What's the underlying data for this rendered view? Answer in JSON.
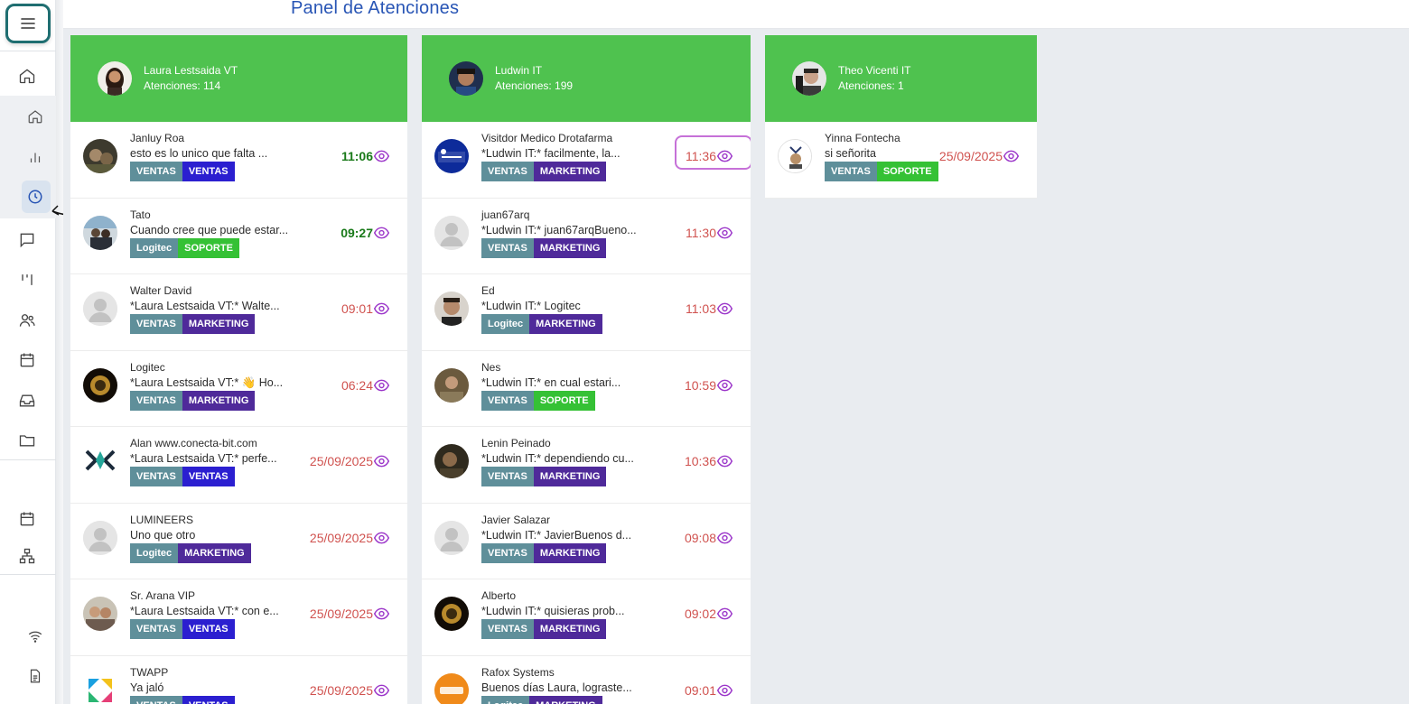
{
  "header": {
    "title": "Panel de Atenciones"
  },
  "colors": {
    "header_green": "#4fc24f",
    "title_blue": "#2855b5",
    "tag_gray": "#5f8f9a",
    "tag_blue": "#2b1fd0",
    "tag_purple": "#4f2a9a",
    "tag_green": "#35c135",
    "time_red": "#d0524f",
    "time_green": "#1a7a1a",
    "eye_purple": "#9b35c9"
  },
  "sidebar": {
    "items": [
      {
        "icon": "menu-icon"
      },
      {
        "icon": "home-icon"
      },
      {
        "icon": "home-sub-icon"
      },
      {
        "icon": "bar-chart-icon"
      },
      {
        "icon": "clock-icon"
      },
      {
        "icon": "chat-icon"
      },
      {
        "icon": "kanban-icon"
      },
      {
        "icon": "users-icon"
      },
      {
        "icon": "calendar-icon"
      },
      {
        "icon": "inbox-icon"
      },
      {
        "icon": "folder-icon"
      },
      {
        "icon": "calendar-alt-icon"
      },
      {
        "icon": "sitemap-icon"
      },
      {
        "icon": "wifi-icon"
      },
      {
        "icon": "document-icon"
      }
    ]
  },
  "columns": [
    {
      "agent": "Laura Lestsaida VT",
      "count": "Atenciones: 114",
      "tickets": [
        {
          "name": "Janluy Roa",
          "msg": "esto es lo unico que falta ...",
          "tags": [
            "VENTAS",
            "VENTAS"
          ],
          "time": "11:06"
        },
        {
          "name": "Tato",
          "msg": "Cuando cree que puede estar...",
          "tags": [
            "Logitec",
            "SOPORTE"
          ],
          "time": "09:27"
        },
        {
          "name": "Walter David",
          "msg": "*Laura Lestsaida VT:* Walte...",
          "tags": [
            "VENTAS",
            "MARKETING"
          ],
          "time": "09:01"
        },
        {
          "name": "Logitec",
          "msg": "*Laura Lestsaida VT:* 👋 Ho...",
          "tags": [
            "VENTAS",
            "MARKETING"
          ],
          "time": "06:24"
        },
        {
          "name": "Alan www.conecta-bit.com",
          "msg": "*Laura Lestsaida VT:* perfe...",
          "tags": [
            "VENTAS",
            "VENTAS"
          ],
          "time": "25/09/2025"
        },
        {
          "name": "LUMINEERS",
          "msg": "Uno que otro",
          "tags": [
            "Logitec",
            "MARKETING"
          ],
          "time": "25/09/2025"
        },
        {
          "name": "Sr. Arana VIP",
          "msg": "*Laura Lestsaida VT:* con e...",
          "tags": [
            "VENTAS",
            "VENTAS"
          ],
          "time": "25/09/2025"
        },
        {
          "name": "TWAPP",
          "msg": "Ya jaló",
          "tags": [
            "VENTAS",
            "VENTAS"
          ],
          "time": "25/09/2025"
        }
      ]
    },
    {
      "agent": "Ludwin IT",
      "count": "Atenciones: 199",
      "tickets": [
        {
          "name": "Visitdor Medico Drotafarma",
          "msg": "*Ludwin IT:* facilmente, la...",
          "tags": [
            "VENTAS",
            "MARKETING"
          ],
          "time": "11:36"
        },
        {
          "name": "juan67arq",
          "msg": "*Ludwin IT:* juan67arqBueno...",
          "tags": [
            "VENTAS",
            "MARKETING"
          ],
          "time": "11:30"
        },
        {
          "name": "Ed",
          "msg": "*Ludwin IT:* Logitec",
          "tags": [
            "Logitec",
            "MARKETING"
          ],
          "time": "11:03"
        },
        {
          "name": "Nes",
          "msg": "*Ludwin IT:* en cual estari...",
          "tags": [
            "VENTAS",
            "SOPORTE"
          ],
          "time": "10:59"
        },
        {
          "name": "Lenin Peinado",
          "msg": "*Ludwin IT:* dependiendo cu...",
          "tags": [
            "VENTAS",
            "MARKETING"
          ],
          "time": "10:36"
        },
        {
          "name": "Javier Salazar",
          "msg": "*Ludwin IT:* JavierBuenos d...",
          "tags": [
            "VENTAS",
            "MARKETING"
          ],
          "time": "09:08"
        },
        {
          "name": "Alberto",
          "msg": "*Ludwin IT:* quisieras prob...",
          "tags": [
            "VENTAS",
            "MARKETING"
          ],
          "time": "09:02"
        },
        {
          "name": "Rafox Systems",
          "msg": "Buenos días Laura, lograste...",
          "tags": [
            "Logitec",
            "MARKETING"
          ],
          "time": "09:01"
        }
      ]
    },
    {
      "agent": "Theo Vicenti IT",
      "count": "Atenciones: 1",
      "tickets": [
        {
          "name": "Yinna Fontecha",
          "msg": "si señorita",
          "tags": [
            "VENTAS",
            "SOPORTE"
          ],
          "time": "25/09/2025"
        }
      ]
    }
  ]
}
